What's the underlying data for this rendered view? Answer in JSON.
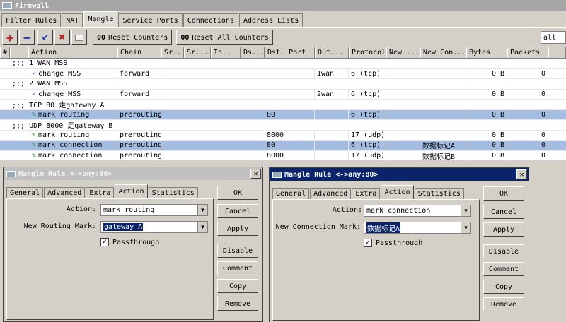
{
  "window": {
    "title": "Firewall"
  },
  "tabs": [
    "Filter Rules",
    "NAT",
    "Mangle",
    "Service Ports",
    "Connections",
    "Address Lists"
  ],
  "active_tab": "Mangle",
  "toolbar": {
    "add_icon": "+",
    "remove_icon": "−",
    "enable_icon": "✔",
    "disable_icon": "✖",
    "reset_counters_label": "Reset Counters",
    "reset_all_counters_label": "Reset All Counters",
    "counter_prefix": "00",
    "filter_value": "all"
  },
  "table": {
    "headers": [
      "#",
      "Action",
      "Chain",
      "Sr...",
      "Sr...",
      "In...",
      "Ds...",
      "Dst. Port",
      "Out...",
      "Protocol",
      "New ...",
      "New Con...",
      "Bytes",
      "Packets"
    ],
    "rows": [
      {
        "type": "comment",
        "text": ";;; 1 WAN MSS"
      },
      {
        "type": "rule",
        "icon": "check",
        "action": "change MSS",
        "chain": "forward",
        "dst_port": "",
        "out": "1wan",
        "protocol": "6 (tcp)",
        "new_conn": "",
        "bytes": "0 B",
        "packets": "0",
        "selected": false
      },
      {
        "type": "comment",
        "text": ";;; 2 WAN MSS"
      },
      {
        "type": "rule",
        "icon": "check",
        "action": "change MSS",
        "chain": "forward",
        "dst_port": "",
        "out": "2wan",
        "protocol": "6 (tcp)",
        "new_conn": "",
        "bytes": "0 B",
        "packets": "0",
        "selected": false
      },
      {
        "type": "comment",
        "text": ";;; TCP 80 走gateway A"
      },
      {
        "type": "rule",
        "icon": "pen",
        "action": "mark routing",
        "chain": "prerouting",
        "dst_port": "80",
        "out": "",
        "protocol": "6 (tcp)",
        "new_conn": "",
        "bytes": "0 B",
        "packets": "0",
        "selected": true
      },
      {
        "type": "comment",
        "text": ";;; UDP 8000 走gateway B"
      },
      {
        "type": "rule",
        "icon": "pen",
        "action": "mark routing",
        "chain": "prerouting",
        "dst_port": "8000",
        "out": "",
        "protocol": "17 (udp)",
        "new_conn": "",
        "bytes": "0 B",
        "packets": "0",
        "selected": false
      },
      {
        "type": "rule",
        "icon": "pen",
        "action": "mark connection",
        "chain": "prerouting",
        "dst_port": "80",
        "out": "",
        "protocol": "6 (tcp)",
        "new_conn": "数据标记A",
        "bytes": "0 B",
        "packets": "0",
        "selected": true
      },
      {
        "type": "rule",
        "icon": "pen",
        "action": "mark connection",
        "chain": "prerouting",
        "dst_port": "8000",
        "out": "",
        "protocol": "17 (udp)",
        "new_conn": "数据标记B",
        "bytes": "0 B",
        "packets": "0",
        "selected": false
      }
    ]
  },
  "dialog1": {
    "title": "Mangle Rule <->any:80>",
    "tabs": [
      "General",
      "Advanced",
      "Extra",
      "Action",
      "Statistics"
    ],
    "active_tab": "Action",
    "action_label": "Action:",
    "action_value": "mark routing",
    "mark_label": "New Routing Mark:",
    "mark_value": "gateway A",
    "passthrough_label": "Passthrough",
    "passthrough_checked": true,
    "buttons": [
      "OK",
      "Cancel",
      "Apply",
      "Disable",
      "Comment",
      "Copy",
      "Remove"
    ],
    "close_icon": "✕"
  },
  "dialog2": {
    "title": "Mangle Rule <->any:80>",
    "tabs": [
      "General",
      "Advanced",
      "Extra",
      "Action",
      "Statistics"
    ],
    "active_tab": "Action",
    "action_label": "Action:",
    "action_value": "mark connection",
    "mark_label": "New Connection Mark:",
    "mark_value": "数据标记A",
    "passthrough_label": "Passthrough",
    "passthrough_checked": true,
    "buttons": [
      "OK",
      "Cancel",
      "Apply",
      "Disable",
      "Comment",
      "Copy",
      "Remove"
    ],
    "close_icon": "✕"
  },
  "colors": {
    "selected_row": "#a4bde0",
    "active_title": "#0a246a",
    "add_icon": "#c81c1c",
    "remove_icon": "#1c36c8"
  },
  "icons": {
    "add": "plus-icon",
    "remove": "minus-icon",
    "enable": "check-icon",
    "disable": "x-icon",
    "comment": "note-icon",
    "rule_check": "check-icon",
    "rule_pen": "pen-icon"
  }
}
